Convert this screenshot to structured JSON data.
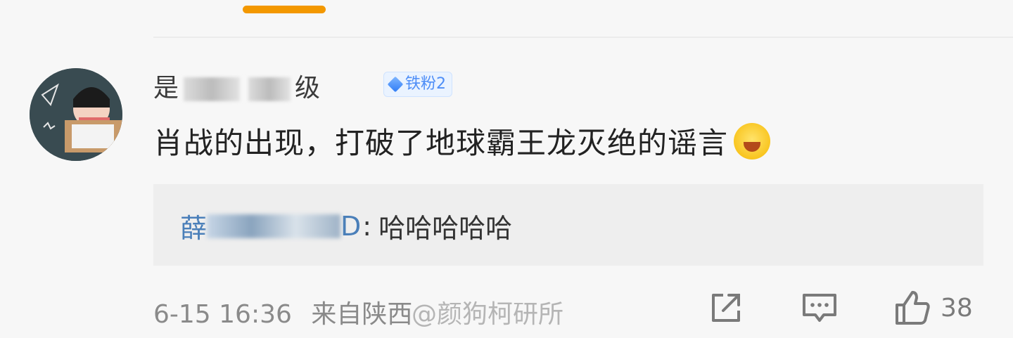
{
  "comment": {
    "username_visible_prefix": "是",
    "username_visible_suffix": "级",
    "badge_label": "铁粉2",
    "text": "肖战的出现，打破了地球霸王龙灭绝的谣言",
    "emoji_icon": "laughing-face-emoji"
  },
  "reply": {
    "name_visible_prefix": "薛",
    "name_visible_suffix": "D",
    "separator": ":",
    "text": "哈哈哈哈哈"
  },
  "meta": {
    "timestamp": "6-15 16:36",
    "location": "来自陕西",
    "watermark": "@颜狗柯研所"
  },
  "actions": {
    "share_icon": "share-icon",
    "comment_icon": "comment-icon",
    "like_icon": "thumbs-up-icon",
    "like_count": "38"
  },
  "colors": {
    "accent_orange": "#f39800",
    "badge_blue": "#4e8ef7",
    "reply_name_blue": "#4a7fb9"
  }
}
